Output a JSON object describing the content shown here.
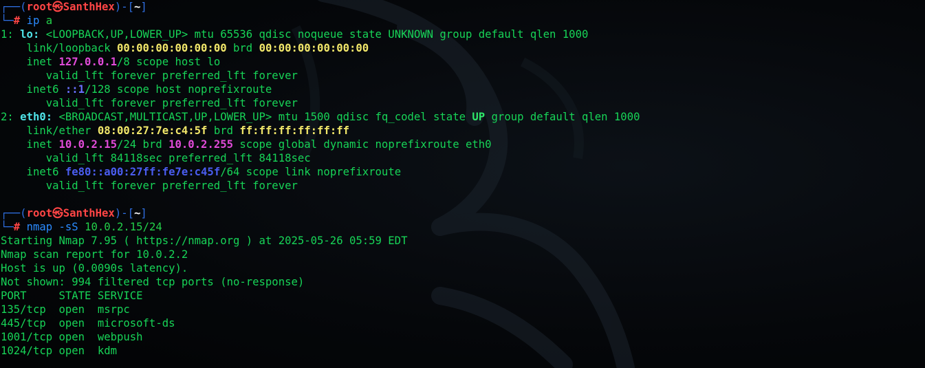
{
  "colors": {
    "frame": "#2f6fe2",
    "user": "#ff4545",
    "dir": "#f4f4f4",
    "command": "#2b8bff",
    "output": "#17d457",
    "iface": "#4fe3e8",
    "mac": "#f1e76a",
    "ipv4": "#e14bd9",
    "ipv6": "#4a5df0"
  },
  "terminal": {
    "lines": [
      [
        {
          "t": "┌──(",
          "c": "frame"
        },
        {
          "t": "root㉿SanthHex",
          "c": "user"
        },
        {
          "t": ")-[",
          "c": "frame"
        },
        {
          "t": "~",
          "c": "dir"
        },
        {
          "t": "]",
          "c": "frame"
        }
      ],
      [
        {
          "t": "└─",
          "c": "frame"
        },
        {
          "t": "#",
          "c": "user"
        },
        {
          "t": " ",
          "c": "norm"
        },
        {
          "t": "ip",
          "c": "cmd"
        },
        {
          "t": " a",
          "c": "arg"
        }
      ],
      [
        {
          "t": "1: ",
          "c": "norm"
        },
        {
          "t": "lo:",
          "c": "iface"
        },
        {
          "t": " <LOOPBACK,UP,LOWER_UP> mtu 65536 qdisc noqueue state UNKNOWN group default qlen 1000",
          "c": "norm"
        }
      ],
      [
        {
          "t": "    link/loopback ",
          "c": "norm"
        },
        {
          "t": "00:00:00:00:00:00",
          "c": "mac"
        },
        {
          "t": " brd ",
          "c": "norm"
        },
        {
          "t": "00:00:00:00:00:00",
          "c": "mac"
        }
      ],
      [
        {
          "t": "    inet ",
          "c": "norm"
        },
        {
          "t": "127.0.0.1",
          "c": "ip4"
        },
        {
          "t": "/8 scope host lo",
          "c": "norm"
        }
      ],
      [
        {
          "t": "       valid_lft forever preferred_lft forever",
          "c": "norm"
        }
      ],
      [
        {
          "t": "    inet6 ",
          "c": "norm"
        },
        {
          "t": "::1",
          "c": "loopip6"
        },
        {
          "t": "/128 scope host noprefixroute",
          "c": "norm"
        }
      ],
      [
        {
          "t": "       valid_lft forever preferred_lft forever",
          "c": "norm"
        }
      ],
      [
        {
          "t": "2: ",
          "c": "norm"
        },
        {
          "t": "eth0:",
          "c": "iface"
        },
        {
          "t": " <BROADCAST,MULTICAST,UP,LOWER_UP> mtu 1500 qdisc fq_codel state ",
          "c": "norm"
        },
        {
          "t": "UP",
          "c": "up"
        },
        {
          "t": " group default qlen 1000",
          "c": "norm"
        }
      ],
      [
        {
          "t": "    link/ether ",
          "c": "norm"
        },
        {
          "t": "08:00:27:7e:c4:5f",
          "c": "mac"
        },
        {
          "t": " brd ",
          "c": "norm"
        },
        {
          "t": "ff:ff:ff:ff:ff:ff",
          "c": "mac"
        }
      ],
      [
        {
          "t": "    inet ",
          "c": "norm"
        },
        {
          "t": "10.0.2.15",
          "c": "ip4"
        },
        {
          "t": "/24 brd ",
          "c": "norm"
        },
        {
          "t": "10.0.2.255",
          "c": "ip4"
        },
        {
          "t": " scope global dynamic noprefixroute eth0",
          "c": "norm"
        }
      ],
      [
        {
          "t": "       valid_lft 84118sec preferred_lft 84118sec",
          "c": "norm"
        }
      ],
      [
        {
          "t": "    inet6 ",
          "c": "norm"
        },
        {
          "t": "fe80::a00:27ff:fe7e:c45f",
          "c": "ip6"
        },
        {
          "t": "/64 scope link noprefixroute",
          "c": "norm"
        }
      ],
      [
        {
          "t": "       valid_lft forever preferred_lft forever",
          "c": "norm"
        }
      ],
      [],
      [
        {
          "t": "┌──(",
          "c": "frame"
        },
        {
          "t": "root㉿SanthHex",
          "c": "user"
        },
        {
          "t": ")-[",
          "c": "frame"
        },
        {
          "t": "~",
          "c": "dir"
        },
        {
          "t": "]",
          "c": "frame"
        }
      ],
      [
        {
          "t": "└─",
          "c": "frame"
        },
        {
          "t": "#",
          "c": "user"
        },
        {
          "t": " ",
          "c": "norm"
        },
        {
          "t": "nmap",
          "c": "cmd"
        },
        {
          "t": " -sS",
          "c": "cmd"
        },
        {
          "t": " 10.0.2.15/24",
          "c": "arg"
        }
      ],
      [
        {
          "t": "Starting Nmap 7.95 ( https://nmap.org ) at 2025-05-26 05:59 EDT",
          "c": "norm"
        }
      ],
      [
        {
          "t": "Nmap scan report for 10.0.2.2",
          "c": "norm"
        }
      ],
      [
        {
          "t": "Host is up (0.0090s latency).",
          "c": "norm"
        }
      ],
      [
        {
          "t": "Not shown: 994 filtered tcp ports (no-response)",
          "c": "norm"
        }
      ],
      [
        {
          "t": "PORT     STATE SERVICE",
          "c": "norm"
        }
      ],
      [
        {
          "t": "135/tcp  open  msrpc",
          "c": "norm"
        }
      ],
      [
        {
          "t": "445/tcp  open  microsoft-ds",
          "c": "norm"
        }
      ],
      [
        {
          "t": "1001/tcp open  webpush",
          "c": "norm"
        }
      ],
      [
        {
          "t": "1024/tcp open  kdm",
          "c": "norm"
        }
      ]
    ]
  }
}
